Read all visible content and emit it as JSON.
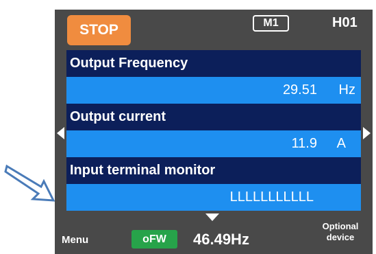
{
  "header": {
    "stop_label": "STOP",
    "mode_badge": "M1",
    "screen_code": "H01"
  },
  "monitors": [
    {
      "label": "Output Frequency",
      "value": "29.51",
      "unit": "Hz"
    },
    {
      "label": "Output current",
      "value": "11.9",
      "unit": "A"
    },
    {
      "label": "Input terminal monitor",
      "value": "LLLLLLLLLLL",
      "unit": ""
    }
  ],
  "footer": {
    "menu_label": "Menu",
    "status_badge": "oFW",
    "frequency_reference": "46.49Hz",
    "optional_device_label": "Optional device"
  },
  "icons": {
    "left": "chevron-left-icon",
    "right": "chevron-right-icon",
    "down": "chevron-down-icon",
    "pointer": "pointer-arrow-icon"
  },
  "colors": {
    "screen_bg": "#494949",
    "stop_orange": "#f08c3f",
    "label_navy": "#0c1f5a",
    "value_blue": "#1e8ff0",
    "ofw_green": "#27a34a",
    "pointer_blue": "#4a7bb8"
  }
}
